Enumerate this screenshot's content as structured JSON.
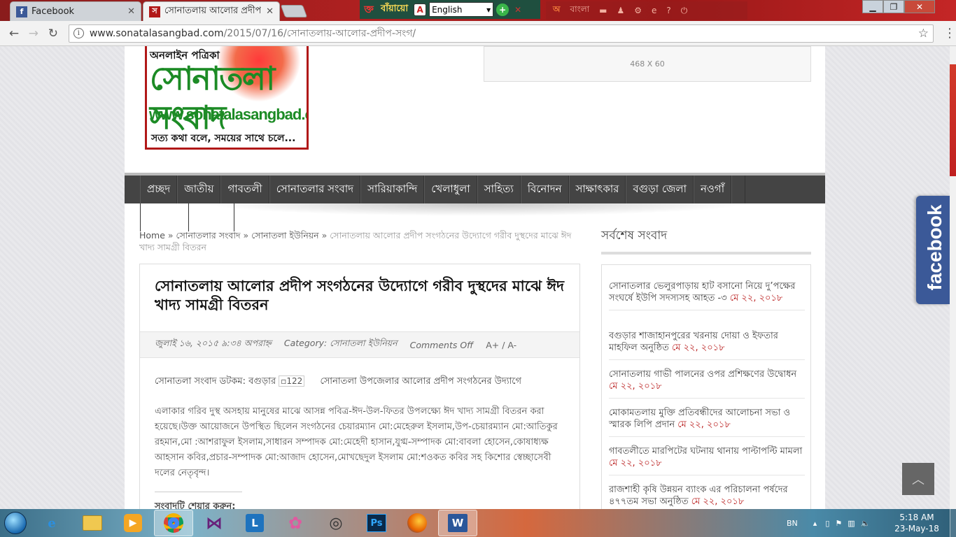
{
  "browser": {
    "tabs": [
      {
        "title": "Facebook",
        "icon": "facebook-icon"
      },
      {
        "title": "সোনাতলায় আলোর প্রদীপ",
        "icon": "site-favicon"
      }
    ],
    "url_host": "www.sonatalasangbad.com",
    "url_path": "/2015/07/16/সোনাতলায়-আলোর-প্রদীপ-সংগ/"
  },
  "ime": {
    "name": "বাঁয়ায়ো",
    "language": "English"
  },
  "ime_bar2": {
    "label": "বাংলা"
  },
  "header": {
    "logo_line1": "অনলাইন পত্রিকা",
    "logo_line2": "সোনাতলা সংবাদ",
    "logo_line3": "www.sonatalasangbad.com",
    "logo_line4": "সত্য কথা বলে, সময়ের সাথে চলে...",
    "ad_label": "468 X 60"
  },
  "nav": [
    "প্রচ্ছদ",
    "জাতীয়",
    "গাবতলী",
    "সোনাতলার সংবাদ",
    "সারিয়াকান্দি",
    "খেলাধুলা",
    "সাহিত্য",
    "বিনোদন",
    "সাক্ষাৎকার",
    "বগুড়া জেলা",
    "নওগাঁ"
  ],
  "breadcrumb": {
    "home": "Home",
    "sep": "»",
    "c1": "সোনাতলার সংবাদ",
    "c2": "সোনাতলা ইউনিয়ন",
    "current": "সোনাতলায় আলোর প্রদীপ সংগঠনের উদ্যোগে গরীব দুস্থদের মাঝে ঈদ খাদ্য সামগ্রী বিতরন"
  },
  "article": {
    "title": "সোনাতলায় আলোর প্রদীপ সংগঠনের উদ্যোগে গরীব দুস্থদের মাঝে ঈদ খাদ্য সামগ্রী বিতরন",
    "date": "জুলাই ১৬, ২০১৫ ৯:৩৪ অপরাহ্ন",
    "category": "Category: সোনাতলা ইউনিয়ন",
    "comments": "Comments Off",
    "font_controls": "A+ / A-",
    "lead": "সোনাতলা সংবাদ ডটকম: বগুড়ার",
    "img_alt": "122",
    "lead2": "সোনাতলা উপজেলার আলোর প্রদীপ সংগঠনের উদ্যাগে",
    "body": "এলাকার গরিব দুস্থ অসহায় মানুষের মাঝে আসন্ন পবিত্র-ঈদ-উল-ফিতর উপলক্ষ্যে ঈদ খাদ্য সামগ্রী বিতরন করা হয়েছে।উক্ত আয়োজনে উপস্থিত ছিলেন সংগঠনের চেয়ারম্যান মো:মেহেরুল ইসলাম,উপ-চেয়ারম্যান মো:আতিকুর রহমান,মো :আশরাফুল ইসলাম,সাধারন সম্পাদক মো:মেহেদী হাসান,যুগ্ম-সম্পাদক মো:বাবলা হোসেন,কোষাধ্যক্ষ আহসান কবির,প্রচার-সম্পাদক মো:আজাদ হোসেন,মোখছেদুল ইসলাম মো:শওকত কবির সহ কিশোর স্বেচ্ছাসেবী দলের নেতৃবৃন্দ।",
    "share_label": "সংবাদটি শেয়ার করুন:"
  },
  "sidebar": {
    "title": "সর্বশেষ সংবাদ",
    "items": [
      {
        "text": "সোনাতলার ভেলুরপাড়ায় হাট বসানো নিয়ে দু’পক্ষের সংঘর্ষে ইউপি সদস্যসহ আহত -৩",
        "date": "মে ২২, ২০১৮"
      },
      {
        "text": "বগুড়ার শাজাহানপুরের খরনায় দোয়া ও ইফতার মাহফিল অনুষ্ঠিত",
        "date": "মে ২২, ২০১৮"
      },
      {
        "text": "সোনাতলায় গাভী পালনের ওপর প্রশিক্ষণের উদ্বোধন",
        "date": "মে ২২, ২০১৮"
      },
      {
        "text": "মোকামতলায় মুক্তি প্রতিবন্ধীদের আলোচনা সভা ও স্মারক লিপি প্রদান",
        "date": "মে ২২, ২০১৮"
      },
      {
        "text": "গাবতলীতে মারপিটের ঘটনায় থানায় পাল্টাপল্টি মামলা",
        "date": "মে ২২, ২০১৮"
      },
      {
        "text": "রাজশাহী কৃষি উন্নয়ন ব্যাংক এর পরিচালনা পর্ষদের ৪৭৭তম সভা অনুষ্ঠিত",
        "date": "মে ২২, ২০১৮"
      }
    ]
  },
  "facebook_tab": "facebook",
  "taskbar": {
    "apps": [
      "ie-icon",
      "explorer-icon",
      "media-player-icon",
      "chrome-icon",
      "visual-studio-icon",
      "lync-icon",
      "paint-icon",
      "app-icon",
      "photoshop-icon",
      "firefox-icon",
      "word-icon"
    ],
    "app_labels": {
      "photoshop": "Ps",
      "word": "W",
      "lync": "L"
    },
    "lang": "BN",
    "time": "5:18 AM",
    "date": "23-May-18"
  }
}
